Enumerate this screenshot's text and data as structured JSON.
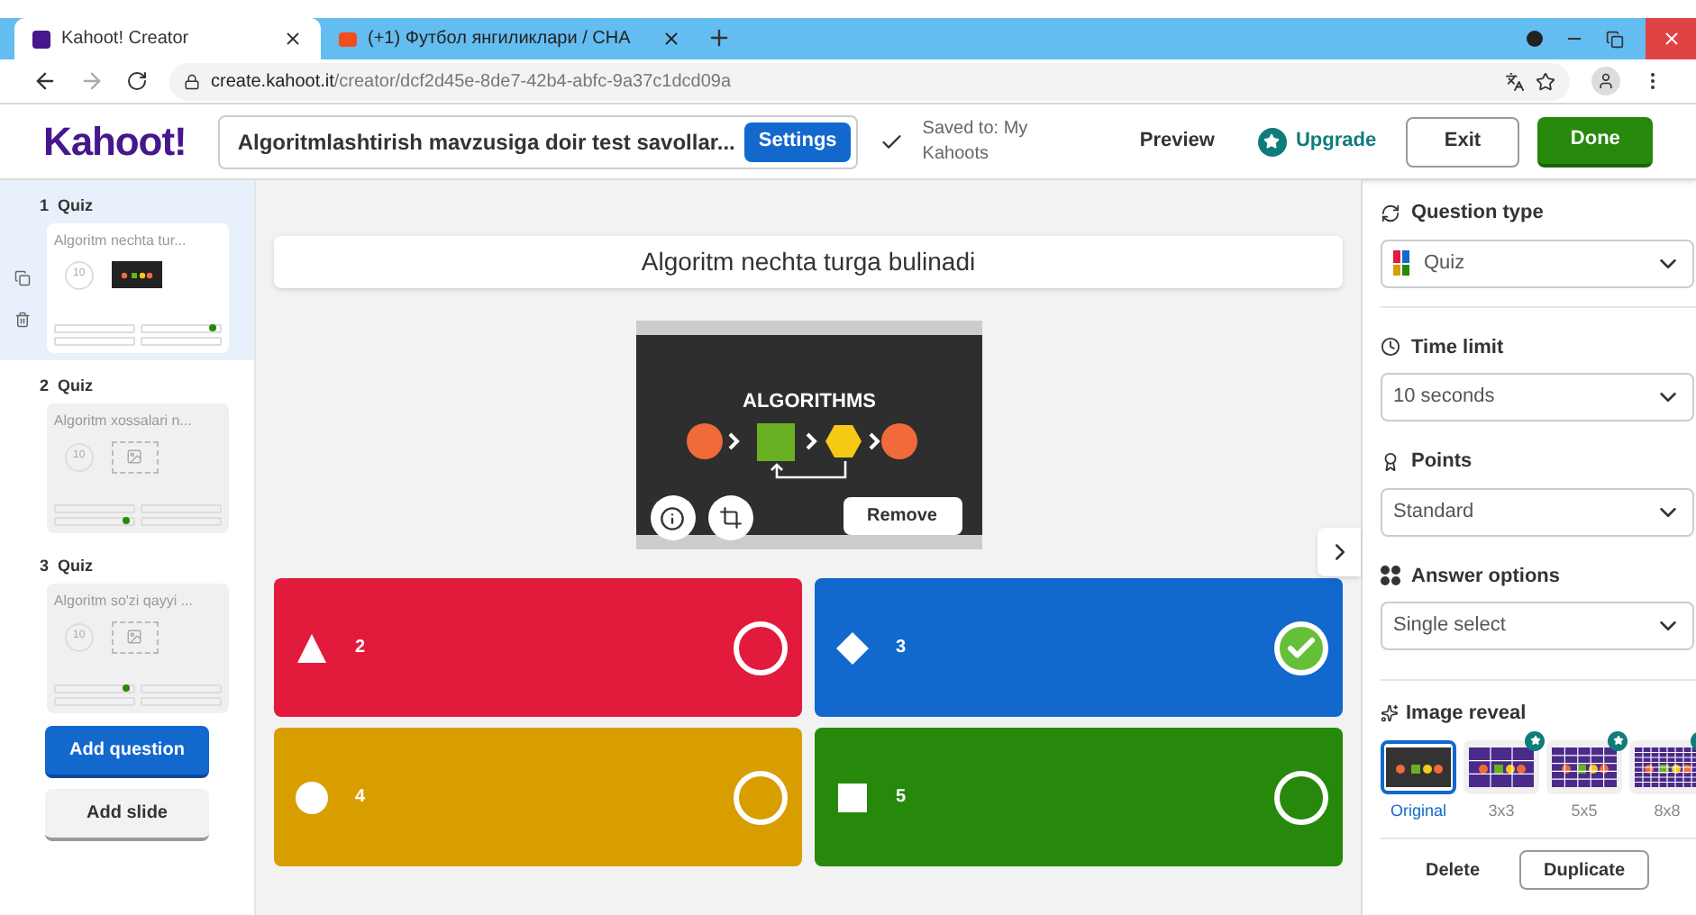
{
  "browser": {
    "tabs": [
      {
        "title": "Kahoot! Creator",
        "selected": true,
        "kind": "kahoot"
      },
      {
        "title": "(+1) Футбол янгиликлари / СНА",
        "selected": false,
        "kind": "other"
      }
    ],
    "url_host": "create.kahoot.it",
    "url_path": "/creator/dcf2d45e-8de7-42b4-abfc-9a37c1dcd09a"
  },
  "header": {
    "logo": "Kahoot!",
    "title": "Algoritmlashtirish mavzusiga doir test savollar...",
    "settings": "Settings",
    "saved": "Saved to: My Kahoots",
    "preview": "Preview",
    "upgrade": "Upgrade",
    "exit": "Exit",
    "done": "Done"
  },
  "slides": [
    {
      "number": "1",
      "type": "Quiz",
      "title": "Algoritm nechta tur...",
      "time": "10",
      "selected": true,
      "has_image": true,
      "answers": [
        {
          "correct": false
        },
        {
          "correct": true
        },
        {
          "correct": false
        },
        {
          "correct": false
        }
      ]
    },
    {
      "number": "2",
      "type": "Quiz",
      "title": "Algoritm xossalari n...",
      "time": "10",
      "selected": false,
      "has_image": false,
      "answers": [
        {
          "correct": false
        },
        {
          "correct": false
        },
        {
          "correct": true
        },
        {
          "correct": false
        }
      ]
    },
    {
      "number": "3",
      "type": "Quiz",
      "title": "Algoritm so'zi qayyi ...",
      "time": "10",
      "selected": false,
      "has_image": false,
      "answers": [
        {
          "correct": true
        },
        {
          "correct": false
        },
        {
          "correct": false
        },
        {
          "correct": false
        }
      ]
    }
  ],
  "sidebar_buttons": {
    "add_question": "Add question",
    "add_slide": "Add slide"
  },
  "question": {
    "text": "Algoritm nechta turga bulinadi",
    "image_caption": "ALGORITHMS",
    "remove": "Remove"
  },
  "answers": [
    {
      "kind": "triangle",
      "text": "2",
      "color": "#e21b3c",
      "correct": false
    },
    {
      "kind": "diamond",
      "text": "3",
      "color": "#1368ce",
      "correct": true
    },
    {
      "kind": "circle",
      "text": "4",
      "color": "#d89e00",
      "correct": false
    },
    {
      "kind": "square",
      "text": "5",
      "color": "#26890c",
      "correct": false
    }
  ],
  "panel": {
    "question_type": {
      "label": "Question type",
      "value": "Quiz"
    },
    "time_limit": {
      "label": "Time limit",
      "value": "10 seconds"
    },
    "points": {
      "label": "Points",
      "value": "Standard"
    },
    "answer_options": {
      "label": "Answer options",
      "value": "Single select"
    },
    "image_reveal": {
      "label": "Image reveal",
      "options": [
        {
          "label": "Original",
          "selected": true,
          "premium": false
        },
        {
          "label": "3x3",
          "selected": false,
          "premium": true
        },
        {
          "label": "5x5",
          "selected": false,
          "premium": true
        },
        {
          "label": "8x8",
          "selected": false,
          "premium": true
        }
      ]
    },
    "delete": "Delete",
    "duplicate": "Duplicate"
  }
}
